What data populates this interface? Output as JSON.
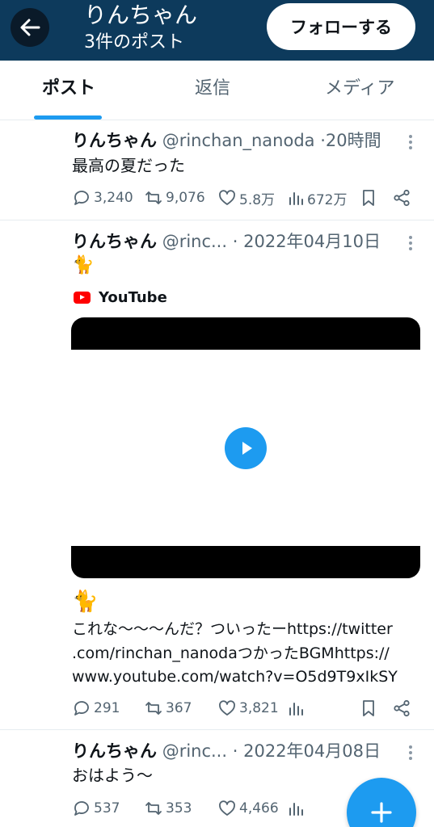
{
  "header": {
    "title": "りんちゃん",
    "post_count": "3件のポスト",
    "follow_label": "フォローする"
  },
  "tabs": [
    {
      "label": "ポスト",
      "active": true
    },
    {
      "label": "返信",
      "active": false
    },
    {
      "label": "メディア",
      "active": false
    }
  ],
  "posts": [
    {
      "name": "りんちゃん",
      "handle": "@rinchan_nanoda",
      "separator": "·",
      "time": "20時間",
      "lines": [
        "最高の夏だった"
      ],
      "replies": "3,240",
      "reposts": "9,076",
      "likes": "5.8万",
      "views": "672万"
    },
    {
      "name": "りんちゃん",
      "handle": "@rinc...",
      "separator": "·",
      "time": "2022年04月10日",
      "emoji_top": "🐈",
      "embed": {
        "site": "YouTube"
      },
      "emoji_bottom": "🐈",
      "lines": [
        "これな〜〜〜んだ？ついったーhttps://twitter",
        ".com/rinchan_nanodaつかったBGMhttps://",
        "www.youtube.com/watch?v=O5d9T9xIkSY"
      ],
      "replies": "291",
      "reposts": "367",
      "likes": "3,821",
      "views": ""
    },
    {
      "name": "りんちゃん",
      "handle": "@rinc...",
      "separator": "·",
      "time": "2022年04月08日",
      "lines": [
        "おはよう〜"
      ],
      "replies": "537",
      "reposts": "353",
      "likes": "4,466",
      "views": ""
    }
  ],
  "colors": {
    "header_bg": "#0d3a5c",
    "accent": "#1d9bf0",
    "muted_text": "#536471",
    "youtube_red": "#ff0000"
  }
}
